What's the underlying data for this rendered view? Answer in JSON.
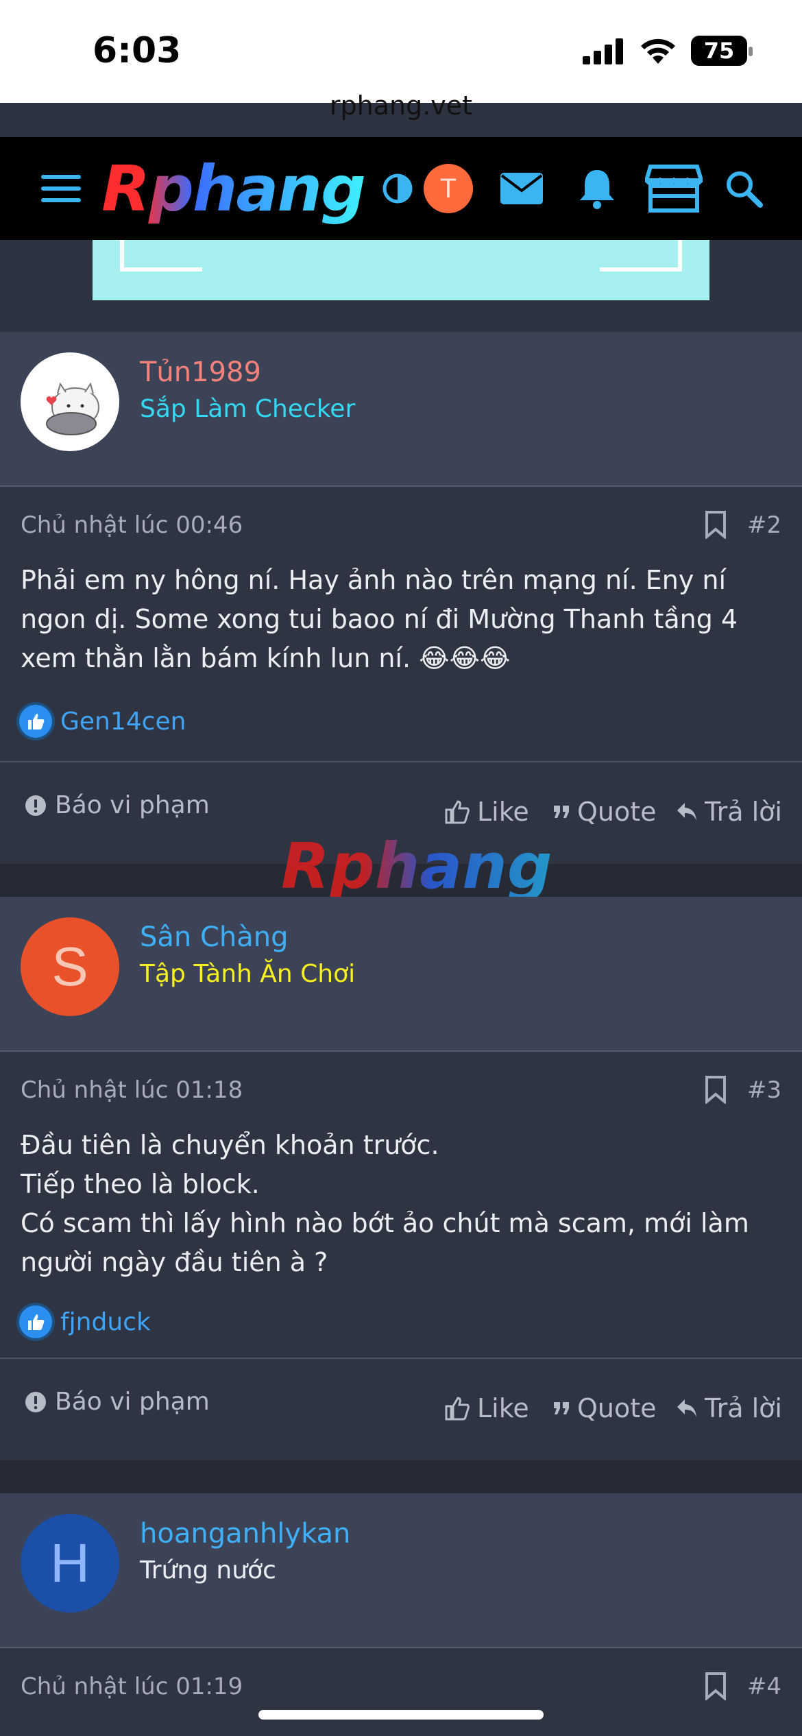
{
  "status_bar": {
    "time": "6:03",
    "battery": "75"
  },
  "browser": {
    "url": "rphang.vet"
  },
  "nav": {
    "logo": "Rphang",
    "user_initial": "T",
    "icons": [
      "menu-icon",
      "theme-toggle-icon",
      "mail-icon",
      "bell-icon",
      "store-icon",
      "search-icon"
    ]
  },
  "watermark": "Rphang",
  "posts": [
    {
      "username": "Tủn1989",
      "user_title": "Sắp Làm Checker",
      "date": "Chủ nhật lúc 00:46",
      "number": "#2",
      "text": "Phải em ny hông ní. Hay ảnh nào trên mạng ní. Eny ní ngon dị. Some xong tui baoo ní đi Mường Thanh tầng 4 xem thằn lằn bám kính lun ní. 😂😂😂",
      "liker": "Gen14cen",
      "colors": {
        "username": "#f4827a",
        "title": "#35d8f2"
      }
    },
    {
      "username": "Sân Chàng",
      "avatar_letter": "S",
      "user_title": "Tập Tành Ăn Chơi",
      "date": "Chủ nhật lúc 01:18",
      "number": "#3",
      "text": "Đầu tiên là chuyển khoản trước.\nTiếp theo là block.\nCó scam thì lấy hình nào bớt ảo chút mà scam, mới làm người ngày đầu tiên à ?",
      "liker": "fjnduck",
      "colors": {
        "username": "#3fb0f7",
        "title": "#f7f21f",
        "avatar": "#e9512a"
      }
    },
    {
      "username": "hoanganhlykan",
      "avatar_letter": "H",
      "user_title": "Trứng nước",
      "date": "Chủ nhật lúc 01:19",
      "number": "#4",
      "colors": {
        "username": "#3fb0f7",
        "title": "#eceef3",
        "avatar": "#1c4fa8"
      }
    }
  ],
  "actions": {
    "report": "Báo vi phạm",
    "like": "Like",
    "quote": "Quote",
    "reply": "Trả lời"
  }
}
